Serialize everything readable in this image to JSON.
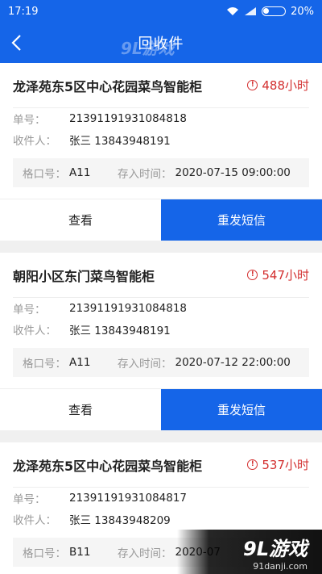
{
  "status": {
    "time": "17:19",
    "battery": "20%"
  },
  "nav": {
    "title": "回收件"
  },
  "labels": {
    "order_no": "单号：",
    "recipient": "收件人：",
    "slot": "格口号：",
    "stored_time": "存入时间：",
    "view": "查看",
    "resend": "重发短信"
  },
  "cards": [
    {
      "location": "龙泽苑东5区中心花园菜鸟智能柜",
      "hours": "488小时",
      "order_no": "21391191931084818",
      "recipient": "张三 13843948191",
      "slot": "A11",
      "stored_time": "2020-07-15 09:00:00"
    },
    {
      "location": "朝阳小区东门菜鸟智能柜",
      "hours": "547小时",
      "order_no": "21391191931084818",
      "recipient": "张三 13843948191",
      "slot": "A11",
      "stored_time": "2020-07-12 22:00:00"
    },
    {
      "location": "龙泽苑东5区中心花园菜鸟智能柜",
      "hours": "537小时",
      "order_no": "21391191931084817",
      "recipient": "张三 13843948209",
      "slot": "B11",
      "stored_time": "2020-07"
    }
  ],
  "watermark": {
    "logo": "9L游戏",
    "url": "91danji.com"
  },
  "colors": {
    "primary": "#1565e8",
    "warning": "#d32f2f"
  }
}
